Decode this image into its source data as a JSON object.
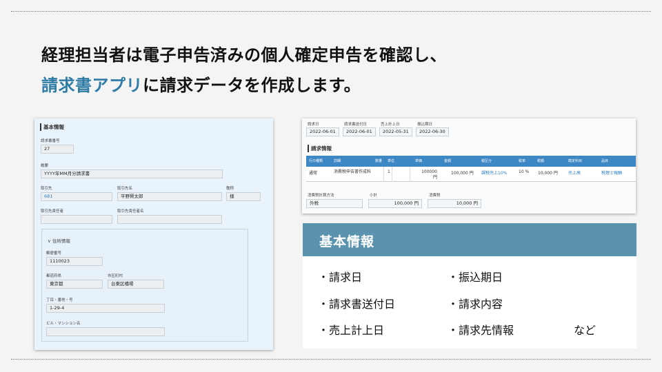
{
  "slide": {
    "title_line1": "経理担当者は電子申告済みの個人確定申告を確認し、",
    "title_line2_highlight": "請求書アプリ",
    "title_line2_rest": "に請求データを作成します。",
    "highlight_color": "#2e7ca5"
  },
  "form": {
    "section_title": "基本情報",
    "invoice_no_label": "請求書番号",
    "invoice_no": "27",
    "summary_label": "概要",
    "summary": "YYYY年MM月分請求書",
    "client_code_label": "取引先",
    "client_code": "681",
    "client_name_label": "取引先名",
    "client_name": "平野賢太郎",
    "honorific_label": "敬称",
    "honorific": "様",
    "contact_label": "取引先責任者",
    "contact_name_label": "取引先責任者名",
    "address_section": "∨ 住所情報",
    "postal_label": "郵便番号",
    "postal": "1110023",
    "prefecture_label": "都道府県",
    "prefecture": "東京都",
    "city_label": "市区町村",
    "city": "台東区橋場",
    "street_label": "丁目・番地・号",
    "street": "1-29-4",
    "building_label": "ビル・マンション名"
  },
  "invoice": {
    "dates": [
      {
        "label": "請求日",
        "value": "2022-06-01"
      },
      {
        "label": "請求書送付日",
        "value": "2022-06-01"
      },
      {
        "label": "売上計上日",
        "value": "2022-05-31"
      },
      {
        "label": "振込期日",
        "value": "2022-06-30"
      }
    ],
    "section_title": "請求情報",
    "columns": [
      "行の種類",
      "詳細",
      "数量",
      "単位",
      "単価",
      "金額",
      "税区分",
      "税率",
      "税額",
      "勘定科目",
      "品目"
    ],
    "row": {
      "type": "通常",
      "detail": "消費税申告書作成料",
      "qty": "1",
      "unit": "",
      "unit_price": "100000 円",
      "amount": "100,000 円",
      "tax_class": "課税売上10%",
      "tax_rate": "10 %",
      "tax_amount": "10,000 円",
      "account": "売上高",
      "item": "税理士報酬"
    },
    "calc_method_label": "消費税計算方法",
    "calc_method": "外税",
    "subtotal_label": "小計",
    "subtotal": "100,000 円",
    "tax_label": "消費税",
    "tax": "10,000 円"
  },
  "card": {
    "title": "基本情報",
    "header_color": "#5b93ae",
    "items": [
      "・請求日",
      "・振込期日",
      "・請求書送付日",
      "・請求内容",
      "・売上計上日",
      "・請求先情報"
    ],
    "etc": "など"
  }
}
